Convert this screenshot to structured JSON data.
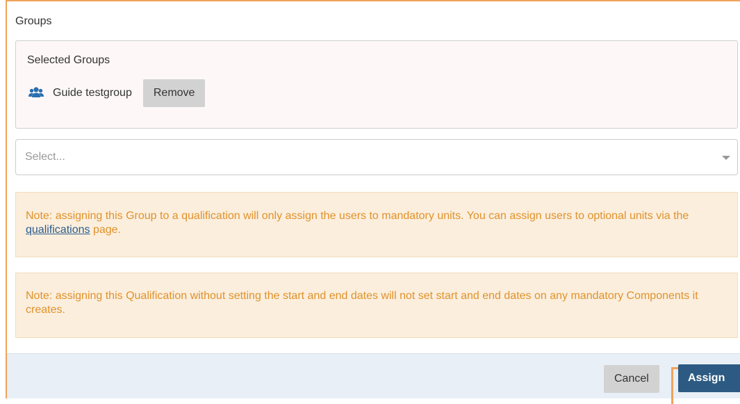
{
  "groups": {
    "heading": "Groups",
    "selected": {
      "title": "Selected Groups",
      "items": [
        {
          "name": "Guide testgroup",
          "icon": "users-group-icon",
          "remove_label": "Remove"
        }
      ]
    },
    "select": {
      "placeholder": "Select..."
    }
  },
  "notes": {
    "group_note": {
      "before_link": "Note: assigning this Group to a qualification will only assign the users to mandatory units. You can assign users to optional units via the ",
      "link_text": "qualifications",
      "after_link": " page."
    },
    "dates_note": {
      "text": "Note: assigning this Qualification without setting the start and end dates will not set start and end dates on any mandatory Components it creates."
    }
  },
  "footer": {
    "cancel_label": "Cancel",
    "assign_label": "Assign"
  },
  "colors": {
    "primary": "#2c5a82",
    "note_text": "#e0922a",
    "note_background": "#fbeedd",
    "highlight": "#f0a35a",
    "group_icon": "#2a6fb0"
  }
}
